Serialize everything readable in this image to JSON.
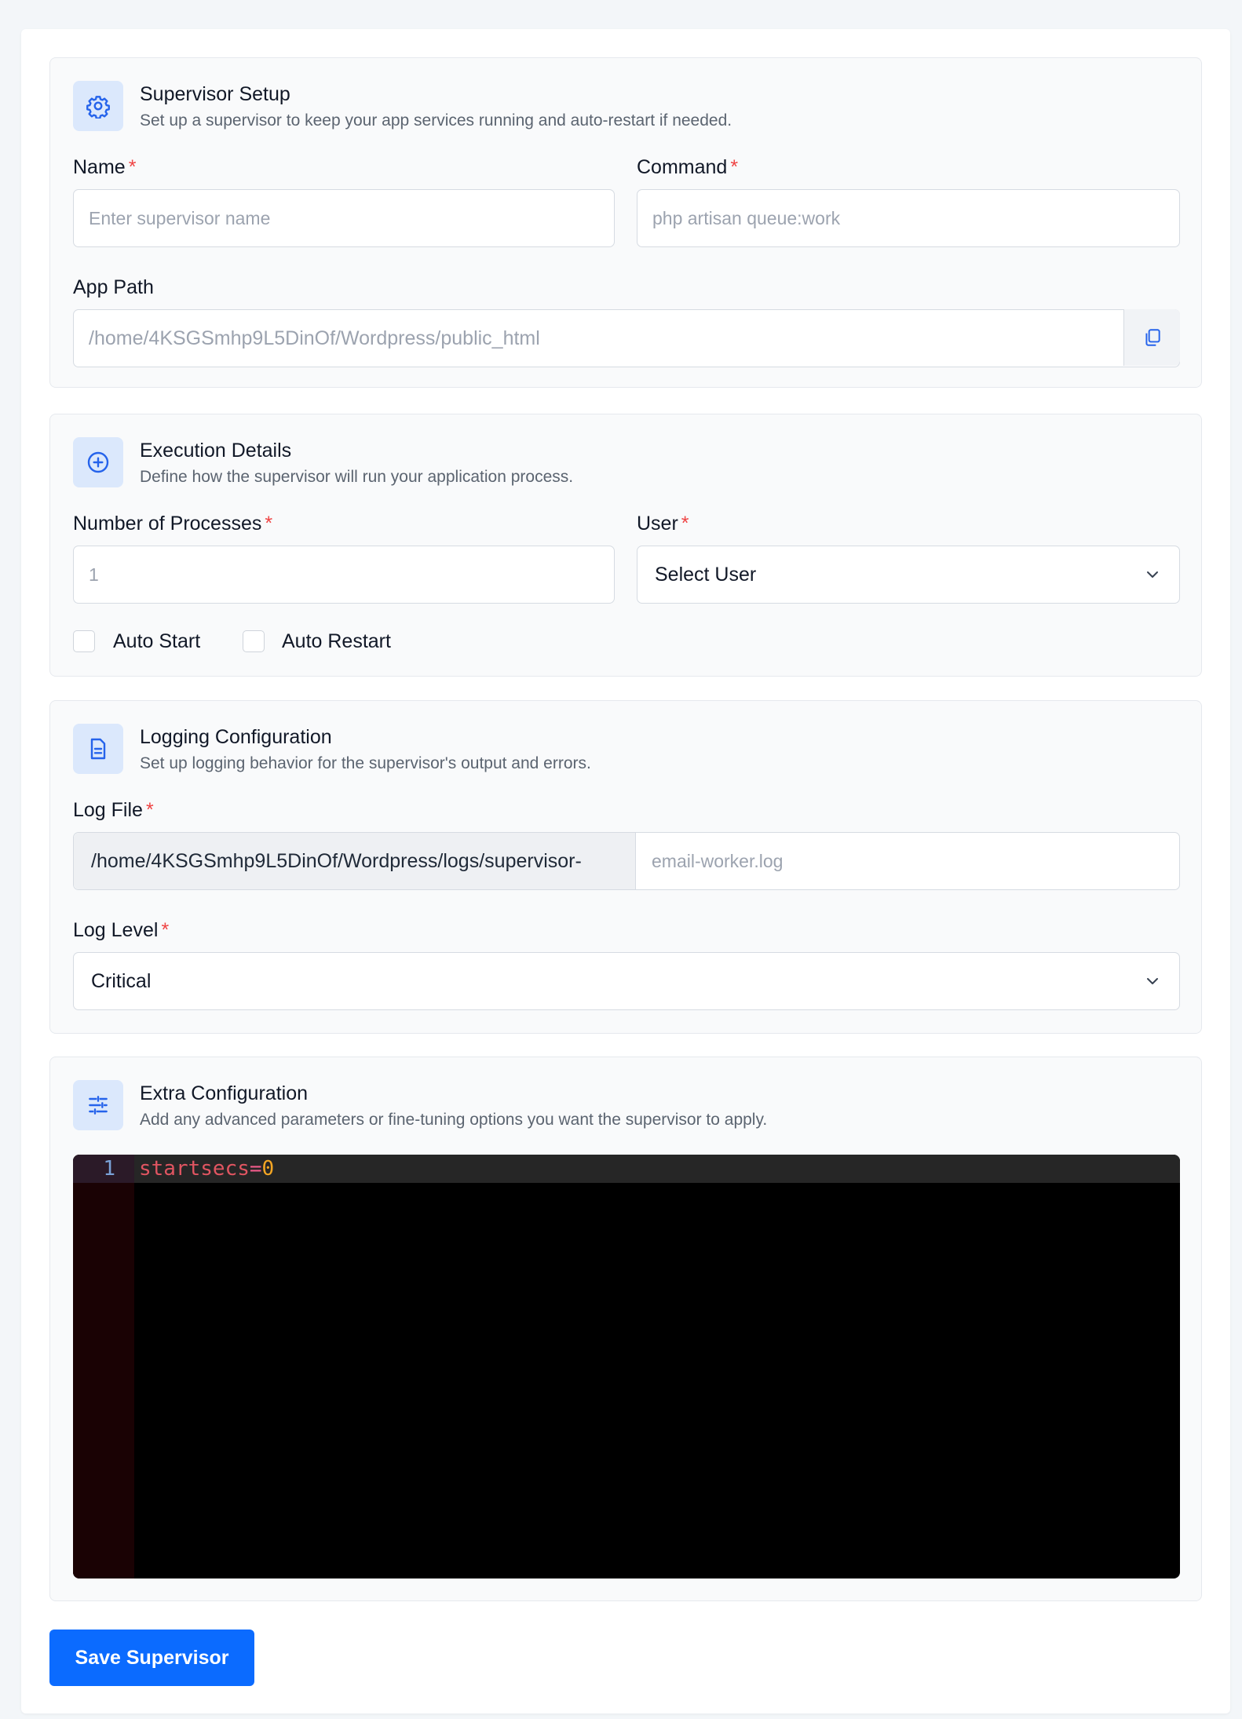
{
  "supervisor_setup": {
    "title": "Supervisor Setup",
    "description": "Set up a supervisor to keep your app services running and auto-restart if needed.",
    "icon": "gear-icon",
    "name_label": "Name",
    "name_placeholder": "Enter supervisor name",
    "command_label": "Command",
    "command_placeholder": "php artisan queue:work",
    "app_path_label": "App Path",
    "app_path_value": "/home/4KSGSmhp9L5DinOf/Wordpress/public_html",
    "copy_icon": "copy-icon"
  },
  "execution_details": {
    "title": "Execution Details",
    "description": "Define how the supervisor will run your application process.",
    "icon": "plus-circle-icon",
    "processes_label": "Number of Processes",
    "processes_placeholder": "1",
    "user_label": "User",
    "user_selected": "Select User",
    "auto_start_label": "Auto Start",
    "auto_restart_label": "Auto Restart"
  },
  "logging_configuration": {
    "title": "Logging Configuration",
    "description": "Set up logging behavior for the supervisor's output and errors.",
    "icon": "document-icon",
    "log_file_label": "Log File",
    "log_file_prefix": "/home/4KSGSmhp9L5DinOf/Wordpress/logs/supervisor-",
    "log_file_placeholder": "email-worker.log",
    "log_level_label": "Log Level",
    "log_level_selected": "Critical"
  },
  "extra_configuration": {
    "title": "Extra Configuration",
    "description": "Add any advanced parameters or fine-tuning options you want the supervisor to apply.",
    "icon": "sliders-icon",
    "editor": {
      "line_number": "1",
      "key": "startsecs",
      "operator": "=",
      "value": "0"
    }
  },
  "required_marker": "*",
  "save_button_label": "Save Supervisor",
  "colors": {
    "accent": "#0b6bff",
    "required": "#ef4444",
    "icon_bg": "#dbe8fc"
  }
}
